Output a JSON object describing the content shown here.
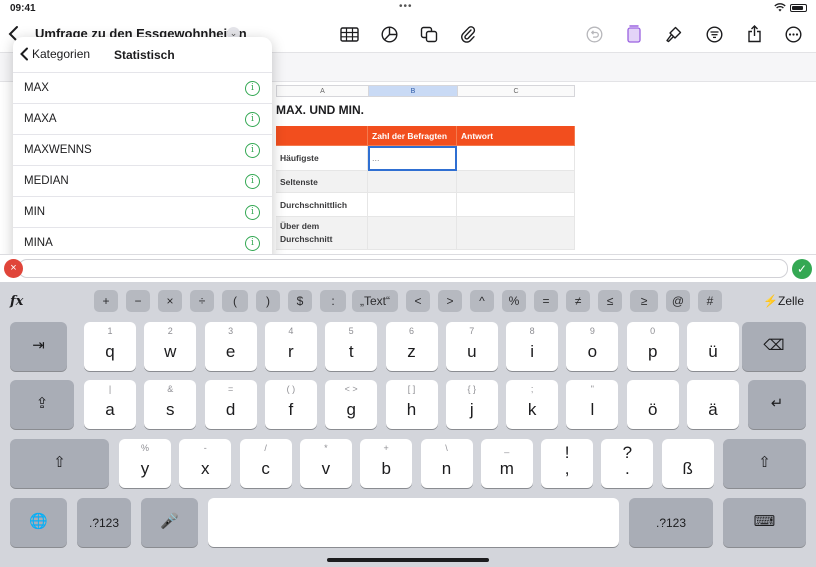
{
  "status_bar": {
    "time": "09:41",
    "dots": "•••"
  },
  "toolbar": {
    "doc_title": "Umfrage zu den Essgewohnheiten",
    "title_chevron": "⌄"
  },
  "sheet": {
    "columns": [
      "A",
      "B",
      "C"
    ],
    "table_title": "MAX. UND MIN.",
    "header": [
      "",
      "Zahl der Befragten",
      "Antwort"
    ],
    "rows": [
      {
        "label": "Häufigste",
        "value": "...",
        "answer": ""
      },
      {
        "label": "Seltenste",
        "value": "",
        "answer": ""
      },
      {
        "label": "Durchschnittlich",
        "value": "",
        "answer": ""
      },
      {
        "label": "Über dem Durchschnitt",
        "value": "",
        "answer": ""
      }
    ]
  },
  "popover": {
    "back_label": "Kategorien",
    "title": "Statistisch",
    "items": [
      "MAX",
      "MAXA",
      "MAXWENNS",
      "MEDIAN",
      "MIN",
      "MINA"
    ],
    "info_glyph": "i"
  },
  "formula_bar": {
    "cancel_glyph": "×",
    "accept_glyph": "✓",
    "value": ""
  },
  "keyboard": {
    "fx": "fx",
    "operators": [
      "+",
      "−",
      "×",
      "÷",
      "(",
      ")",
      "$",
      ":",
      "„Text“",
      "<",
      ">",
      "^",
      "%",
      "=",
      "≠",
      "≤",
      "≥",
      "@",
      "#"
    ],
    "cell_mode": "⚡Zelle",
    "row1": [
      {
        "hint": "1",
        "key": "q"
      },
      {
        "hint": "2",
        "key": "w"
      },
      {
        "hint": "3",
        "key": "e"
      },
      {
        "hint": "4",
        "key": "r"
      },
      {
        "hint": "5",
        "key": "t"
      },
      {
        "hint": "6",
        "key": "z"
      },
      {
        "hint": "7",
        "key": "u"
      },
      {
        "hint": "8",
        "key": "i"
      },
      {
        "hint": "9",
        "key": "o"
      },
      {
        "hint": "0",
        "key": "p"
      },
      {
        "hint": "",
        "key": "ü"
      }
    ],
    "row2": [
      {
        "hint": "|",
        "key": "a"
      },
      {
        "hint": "&",
        "key": "s"
      },
      {
        "hint": "=",
        "key": "d"
      },
      {
        "hint": "( )",
        "key": "f"
      },
      {
        "hint": "< >",
        "key": "g"
      },
      {
        "hint": "[ ]",
        "key": "h"
      },
      {
        "hint": "{ }",
        "key": "j"
      },
      {
        "hint": ";",
        "key": "k"
      },
      {
        "hint": "\"",
        "key": "l"
      },
      {
        "hint": "",
        "key": "ö"
      },
      {
        "hint": "",
        "key": "ä"
      }
    ],
    "row3": [
      {
        "hint": "%",
        "key": "y"
      },
      {
        "hint": "-",
        "key": "x"
      },
      {
        "hint": "/",
        "key": "c"
      },
      {
        "hint": "*",
        "key": "v"
      },
      {
        "hint": "+",
        "key": "b"
      },
      {
        "hint": "\\",
        "key": "n"
      },
      {
        "hint": "_",
        "key": "m"
      },
      {
        "hint": "",
        "key": "!\n,"
      },
      {
        "hint": "",
        "key": "?\n."
      },
      {
        "hint": "",
        "key": "ß"
      }
    ],
    "tab_glyph": "⇥",
    "delete_glyph": "⌫",
    "caps_glyph": "⇪",
    "return_glyph": "↵",
    "shift_glyph": "⇧",
    "globe_glyph": "🌐",
    "numbers_label": ".?123",
    "mic_glyph": "🎤",
    "hide_glyph": "⌨"
  }
}
